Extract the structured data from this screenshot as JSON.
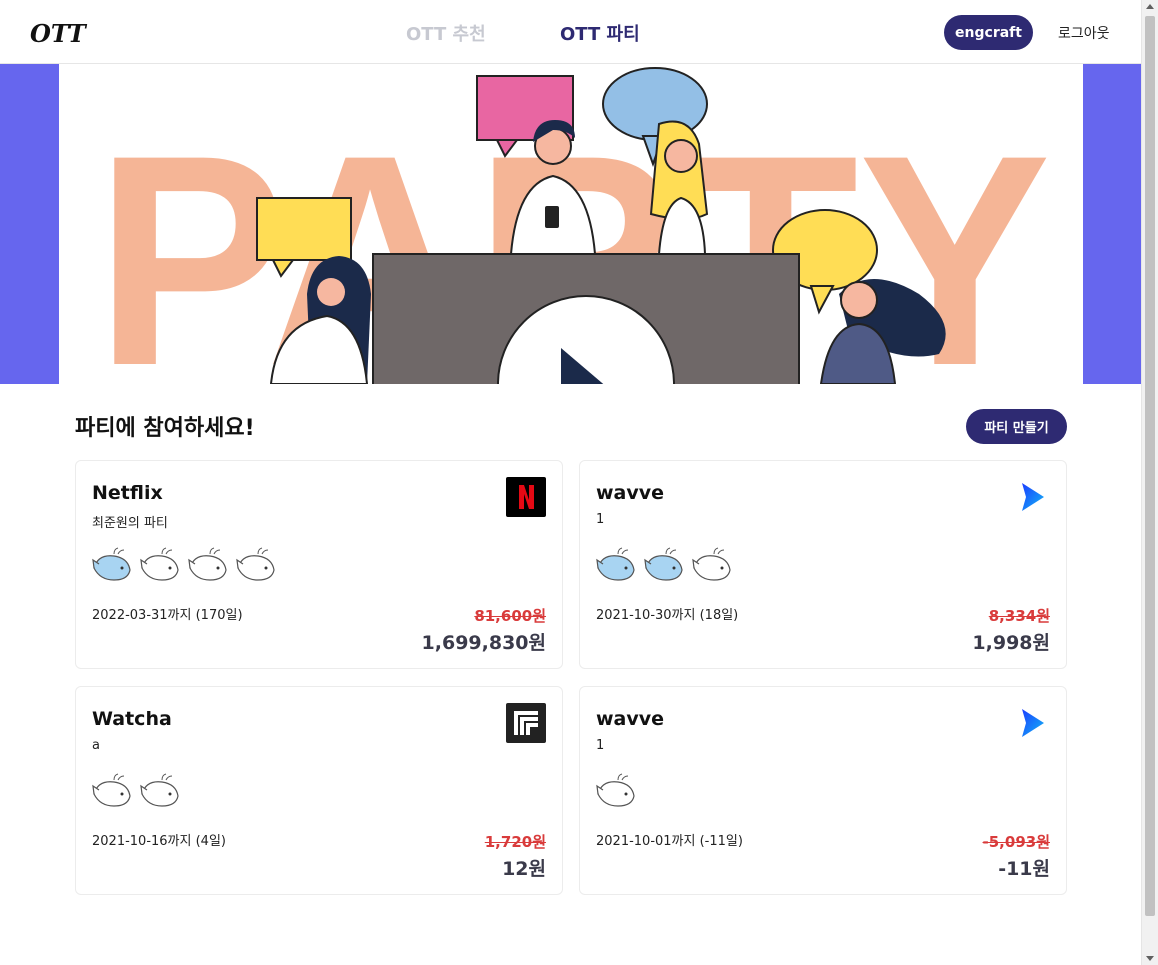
{
  "header": {
    "logo_text": "OTT",
    "nav": {
      "recommend_label": "OTT 추천",
      "party_label": "OTT 파티"
    },
    "user_label": "engcraft",
    "logout_label": "로그아웃"
  },
  "banner": {
    "word": "PARTY"
  },
  "section": {
    "title": "파티에 참여하세요!",
    "create_label": "파티 만들기"
  },
  "cards": [
    {
      "service": "Netflix",
      "host": "최준원의 파티",
      "members_joined": 1,
      "members_total": 4,
      "date": "2022-03-31까지 (170일)",
      "original_price": "81,600원",
      "price": "1,699,830원",
      "logo": "netflix-logo"
    },
    {
      "service": "wavve",
      "host": "1",
      "members_joined": 2,
      "members_total": 3,
      "date": "2021-10-30까지 (18일)",
      "original_price": "8,334원",
      "price": "1,998원",
      "logo": "wavve-logo"
    },
    {
      "service": "Watcha",
      "host": "a",
      "members_joined": 0,
      "members_total": 2,
      "date": "2021-10-16까지 (4일)",
      "original_price": "1,720원",
      "price": "12원",
      "logo": "watcha-logo"
    },
    {
      "service": "wavve",
      "host": "1",
      "members_joined": 0,
      "members_total": 1,
      "date": "2021-10-01까지 (-11일)",
      "original_price": "-5,093원",
      "price": "-11원",
      "logo": "wavve-logo"
    }
  ],
  "colors": {
    "brand": "#2e2a72",
    "banner_side": "#6666ee",
    "strike": "#d93b3b",
    "whale_filled": "#a8d4f2"
  }
}
